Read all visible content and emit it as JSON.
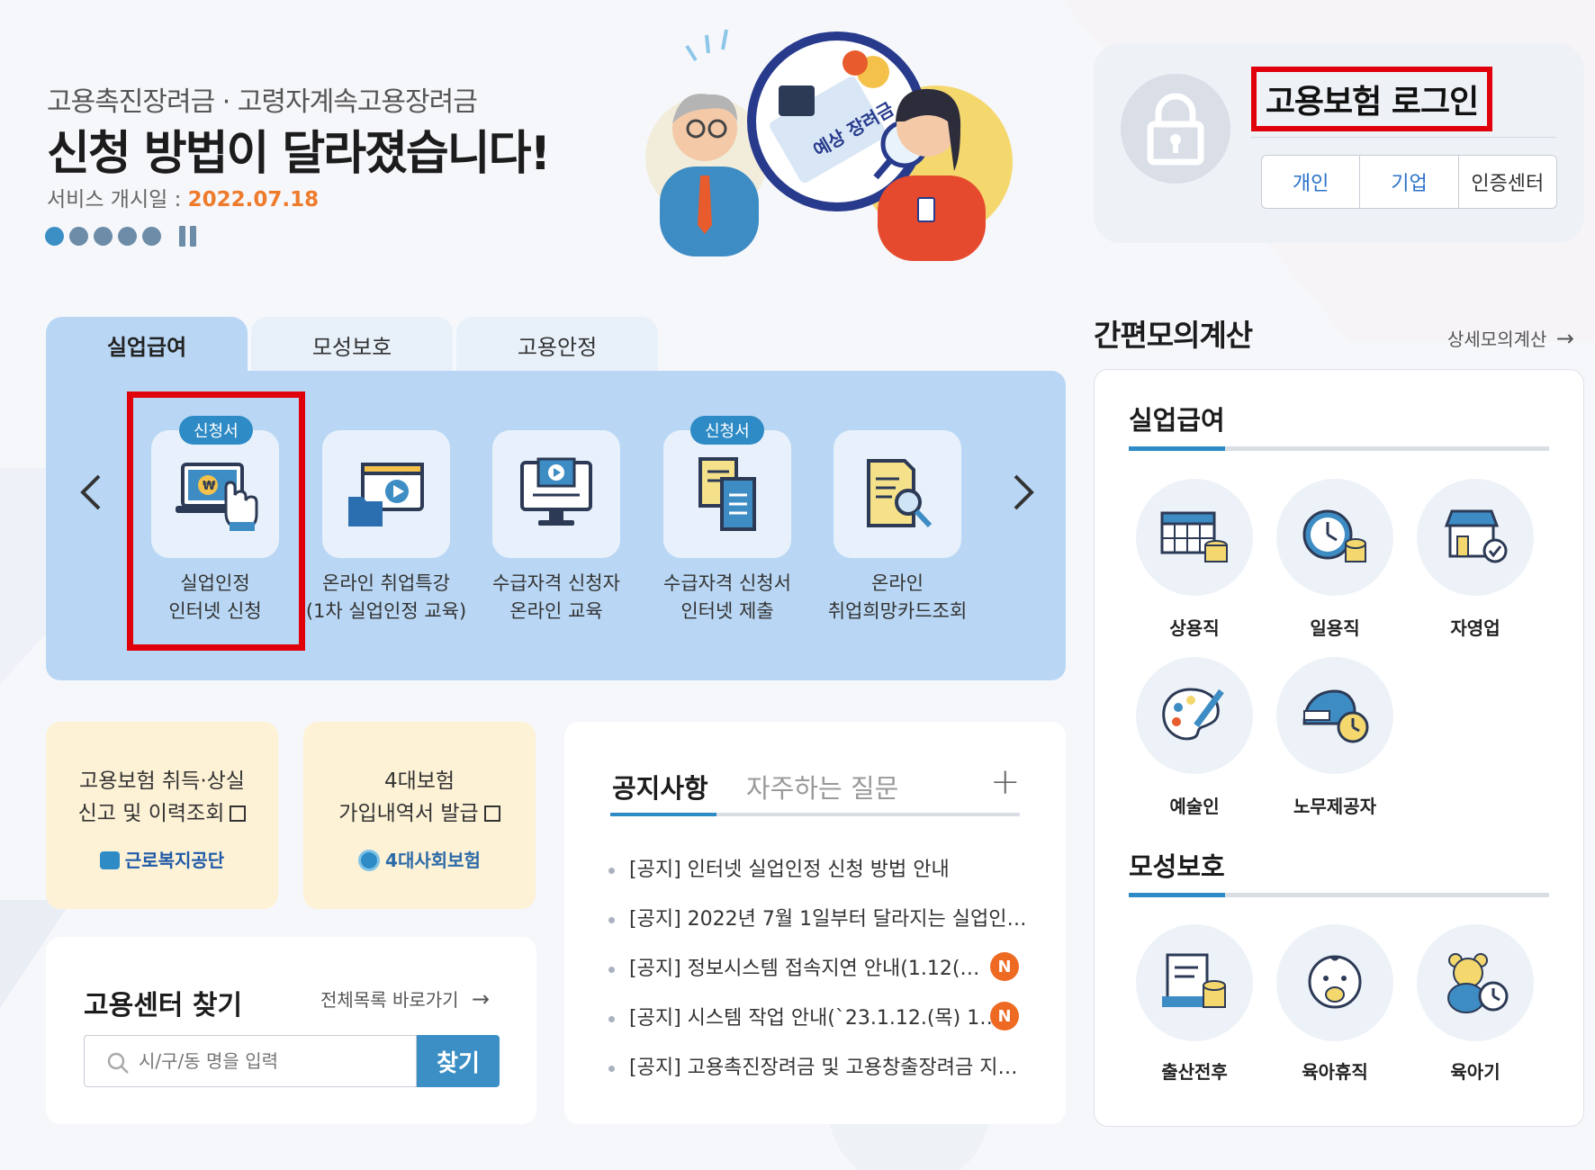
{
  "banner": {
    "subtitle": "고용촉진장려금 · 고령자계속고용장려금",
    "title": "신청 방법이 달라졌습니다!",
    "date_label": "서비스 개시일 :",
    "date_value": "2022.07.18",
    "illustration_text": "예상 장려금"
  },
  "login": {
    "title": "고용보험 로그인",
    "buttons": [
      "개인",
      "기업",
      "인증센터"
    ]
  },
  "tabs": [
    "실업급여",
    "모성보호",
    "고용안정"
  ],
  "services": [
    {
      "badge": "신청서",
      "line1": "실업인정",
      "line2": "인터넷 신청",
      "icon": "laptop-won-hand-icon"
    },
    {
      "badge": "",
      "line1": "온라인 취업특강",
      "line2": "(1차 실업인정 교육)",
      "icon": "video-folder-icon"
    },
    {
      "badge": "",
      "line1": "수급자격 신청자",
      "line2": "온라인 교육",
      "icon": "monitor-play-icon"
    },
    {
      "badge": "신청서",
      "line1": "수급자격 신청서",
      "line2": "인터넷 제출",
      "icon": "documents-icon"
    },
    {
      "badge": "",
      "line1": "온라인",
      "line2": "취업희망카드조회",
      "icon": "document-search-icon"
    }
  ],
  "quick": [
    {
      "line1": "고용보험 취득·상실",
      "line2": "신고 및 이력조회",
      "logo": "근로복지공단",
      "logo_color": "#1e5aa8"
    },
    {
      "line1": "4대보험",
      "line2": "가입내역서 발급",
      "logo": "4대사회보험",
      "logo_color": "#2a6aa8"
    }
  ],
  "find_center": {
    "title": "고용센터 찾기",
    "link": "전체목록 바로가기",
    "placeholder": "시/구/동 명을 입력",
    "button": "찾기"
  },
  "notice": {
    "tab_active": "공지사항",
    "tab_inactive": "자주하는 질문",
    "plus": "+",
    "items": [
      {
        "text": "[공지] 인터넷 실업인정 신청 방법 안내",
        "badge": ""
      },
      {
        "text": "[공지] 2022년 7월 1일부터 달라지는 실업인…",
        "badge": ""
      },
      {
        "text": "[공지] 정보시스템 접속지연 안내(1.12(…",
        "badge": "N"
      },
      {
        "text": "[공지] 시스템 작업 안내(`23.1.12.(목) 1…",
        "badge": "N"
      },
      {
        "text": "[공지] 고용촉진장려금 및 고용창출장려금 지…",
        "badge": ""
      }
    ]
  },
  "calculator": {
    "title": "간편모의계산",
    "link": "상세모의계산",
    "sections": [
      {
        "title": "실업급여",
        "items": [
          {
            "label": "상용직",
            "icon": "calendar-coins-icon"
          },
          {
            "label": "일용직",
            "icon": "clock-coins-icon"
          },
          {
            "label": "자영업",
            "icon": "store-check-icon"
          },
          {
            "label": "예술인",
            "icon": "palette-icon"
          },
          {
            "label": "노무제공자",
            "icon": "helmet-clock-icon"
          }
        ]
      },
      {
        "title": "모성보호",
        "items": [
          {
            "label": "출산전후",
            "icon": "document-coins-icon"
          },
          {
            "label": "육아휴직",
            "icon": "baby-icon"
          },
          {
            "label": "육아기",
            "icon": "teddy-clock-icon"
          }
        ]
      }
    ]
  },
  "colors": {
    "accent": "#2f8bc5",
    "highlight": "#e0000b",
    "panel": "#b9d7f4",
    "badge_new": "#ee6a23",
    "date": "#ee7b2c"
  }
}
